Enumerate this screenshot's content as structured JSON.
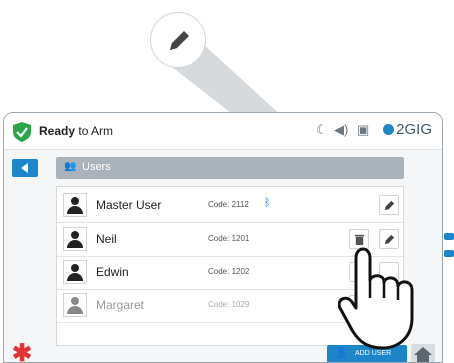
{
  "status_bar": {
    "status_bold": "Ready",
    "status_rest": "to Arm",
    "brand": "2GIG"
  },
  "header": {
    "title": "Users"
  },
  "users": [
    {
      "name": "Master User",
      "code": "Code: 2112"
    },
    {
      "name": "Neil",
      "code": "Code: 1201"
    },
    {
      "name": "Edwin",
      "code": "Code: 1202"
    },
    {
      "name": "Margaret",
      "code": "Code: 1029"
    }
  ],
  "footer": {
    "add_user": "ADD USER"
  },
  "colors": {
    "accent": "#1c86c9",
    "alert": "#e03336",
    "ok": "#2aa54a"
  },
  "icons": [
    "shield-check-icon",
    "moon-icon",
    "speaker-icon",
    "camera-icon",
    "pencil-icon",
    "trash-icon",
    "bluetooth-icon",
    "home-icon",
    "add-person-icon",
    "asterisk-icon"
  ]
}
